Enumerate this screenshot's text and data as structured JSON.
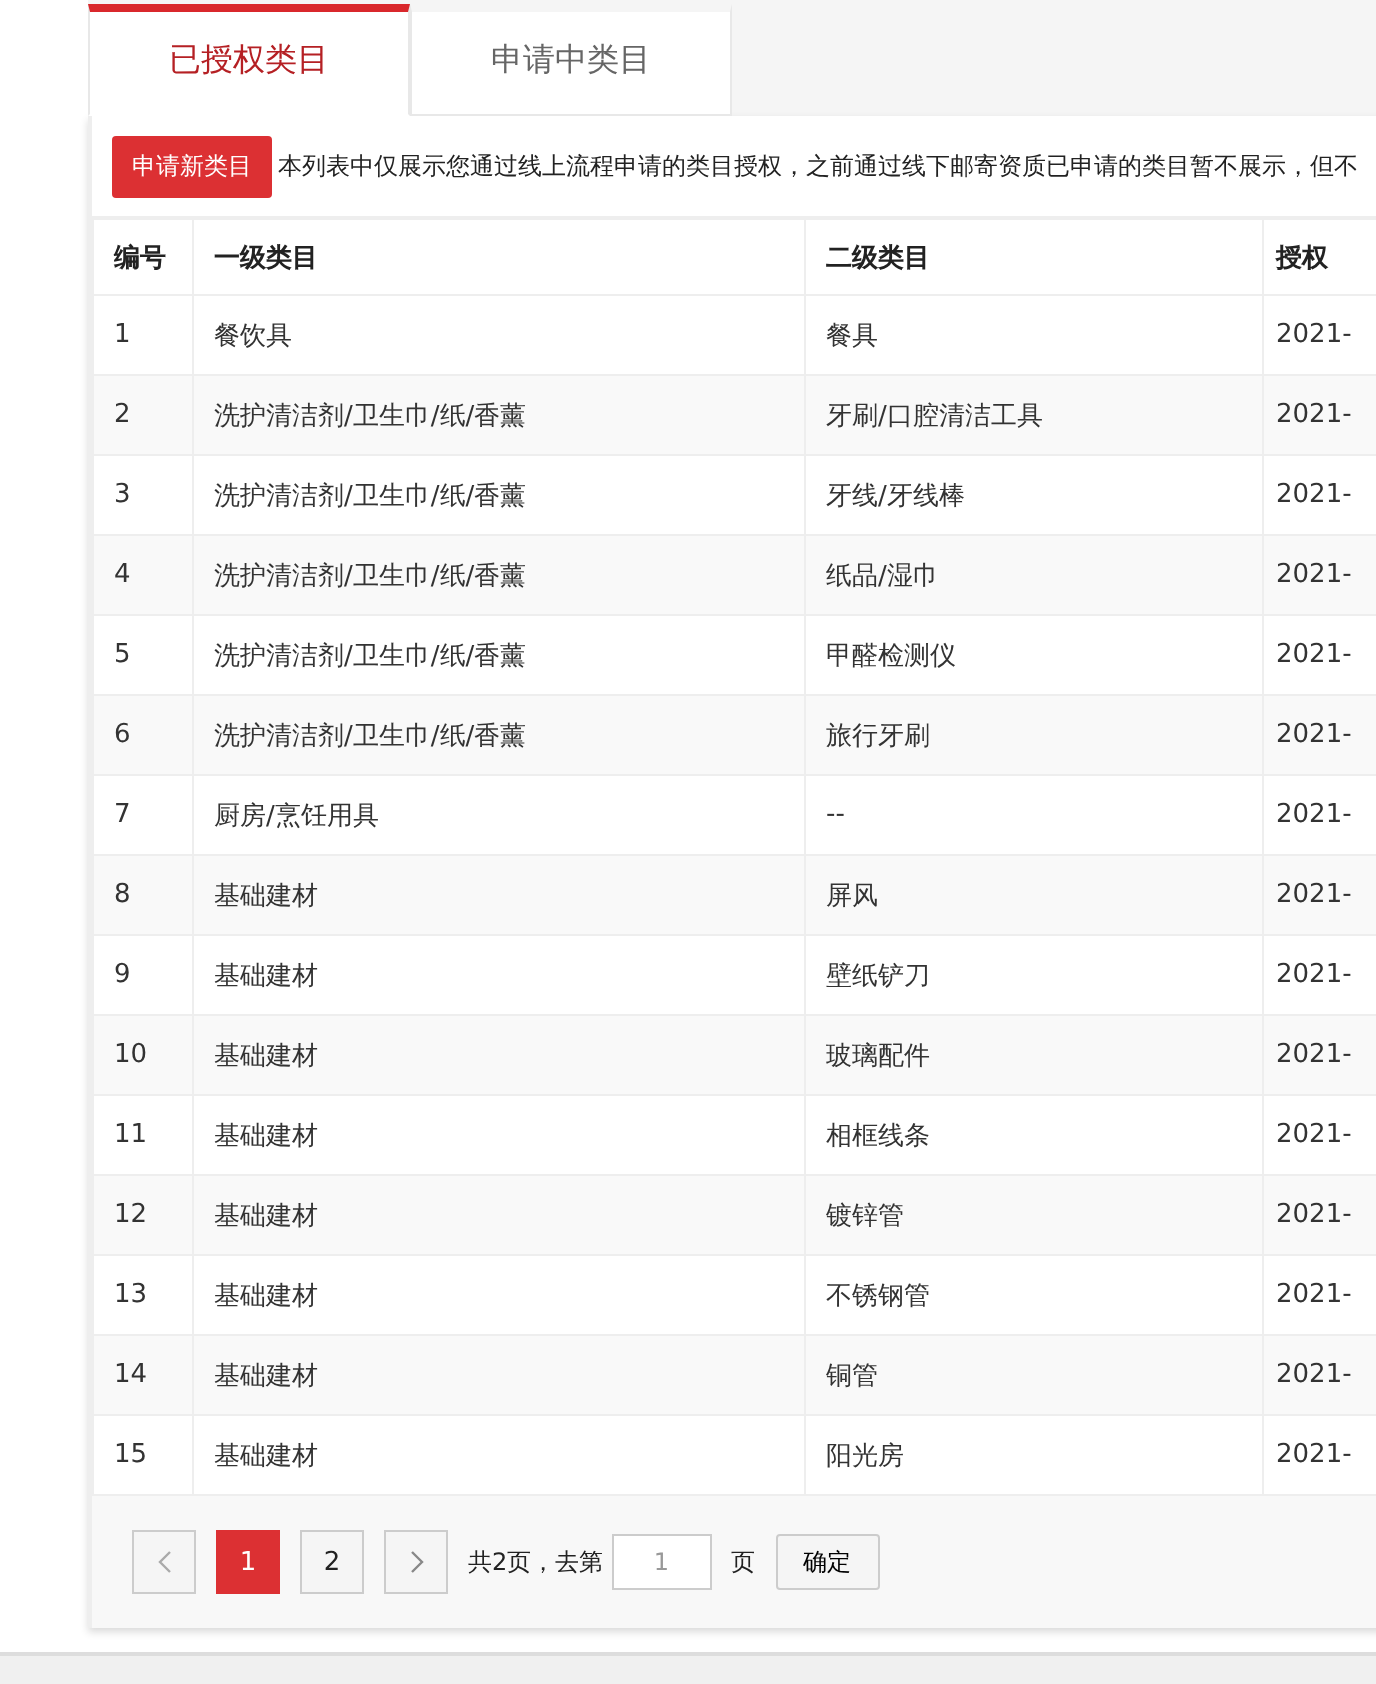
{
  "tabs": [
    {
      "label": "已授权类目",
      "selected": true
    },
    {
      "label": "申请中类目",
      "selected": false
    }
  ],
  "toolbar": {
    "button": "申请新类目",
    "notice": "本列表中仅展示您通过线上流程申请的类目授权，之前通过线下邮寄资质已申请的类目暂不展示，但不"
  },
  "table": {
    "columns": [
      "编号",
      "一级类目",
      "二级类目",
      "授权"
    ],
    "rows": [
      [
        "1",
        "餐饮具",
        "餐具",
        "2021-"
      ],
      [
        "2",
        "洗护清洁剂/卫生巾/纸/香薰",
        "牙刷/口腔清洁工具",
        "2021-"
      ],
      [
        "3",
        "洗护清洁剂/卫生巾/纸/香薰",
        "牙线/牙线棒",
        "2021-"
      ],
      [
        "4",
        "洗护清洁剂/卫生巾/纸/香薰",
        "纸品/湿巾",
        "2021-"
      ],
      [
        "5",
        "洗护清洁剂/卫生巾/纸/香薰",
        "甲醛检测仪",
        "2021-"
      ],
      [
        "6",
        "洗护清洁剂/卫生巾/纸/香薰",
        "旅行牙刷",
        "2021-"
      ],
      [
        "7",
        "厨房/烹饪用具",
        "--",
        "2021-"
      ],
      [
        "8",
        "基础建材",
        "屏风",
        "2021-"
      ],
      [
        "9",
        "基础建材",
        "壁纸铲刀",
        "2021-"
      ],
      [
        "10",
        "基础建材",
        "玻璃配件",
        "2021-"
      ],
      [
        "11",
        "基础建材",
        "相框线条",
        "2021-"
      ],
      [
        "12",
        "基础建材",
        "镀锌管",
        "2021-"
      ],
      [
        "13",
        "基础建材",
        "不锈钢管",
        "2021-"
      ],
      [
        "14",
        "基础建材",
        "铜管",
        "2021-"
      ],
      [
        "15",
        "基础建材",
        "阳光房",
        "2021-"
      ]
    ]
  },
  "pagination": {
    "pages": [
      {
        "label": "1",
        "selected": true
      },
      {
        "label": "2",
        "selected": false
      }
    ],
    "total_text": "共2页，去第",
    "page_input": "1",
    "page_suffix": "页",
    "confirm": "确定"
  }
}
